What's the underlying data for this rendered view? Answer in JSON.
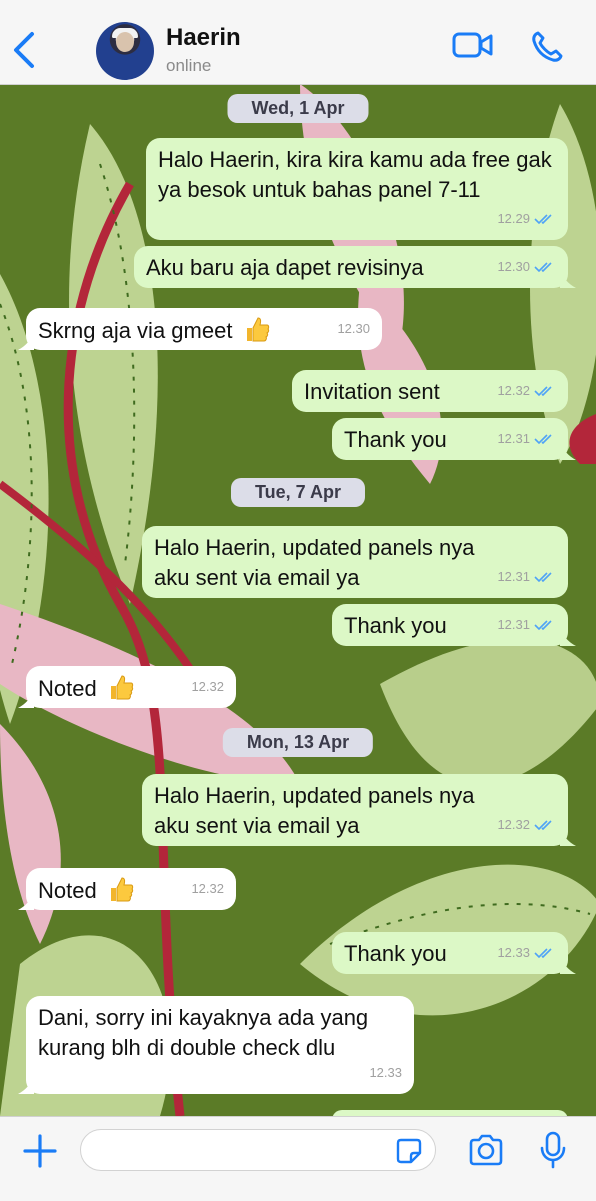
{
  "header": {
    "contact_name": "Haerin",
    "status": "online",
    "accent_color": "#1a7cf6"
  },
  "icons": {
    "back": "chevron-left-icon",
    "video_call": "video-camera-icon",
    "voice_call": "phone-icon",
    "attach": "plus-icon",
    "sticker": "sticker-icon",
    "camera": "camera-icon",
    "mic": "microphone-icon",
    "read_receipt": "double-check-icon",
    "thumbs": "thumbs-up-emoji"
  },
  "dates": [
    "Wed, 1 Apr",
    "Tue, 7 Apr",
    "Mon, 13 Apr"
  ],
  "messages": [
    {
      "dir": "out",
      "text": "Halo Haerin, kira kira kamu ada free gak ya besok untuk bahas panel 7-11",
      "time": "12.29"
    },
    {
      "dir": "out",
      "text": "Aku baru aja dapet revisinya",
      "time": "12.30"
    },
    {
      "dir": "in",
      "text": "Skrng aja via gmeet",
      "time": "12.30",
      "emoji": "thumbs-up"
    },
    {
      "dir": "out",
      "text": "Invitation sent",
      "time": "12.32"
    },
    {
      "dir": "out",
      "text": "Thank you",
      "time": "12.31"
    },
    {
      "dir": "out",
      "text": "Halo Haerin, updated panels nya aku sent via email ya",
      "time": "12.31"
    },
    {
      "dir": "out",
      "text": "Thank you",
      "time": "12.31"
    },
    {
      "dir": "in",
      "text": "Noted",
      "time": "12.32",
      "emoji": "thumbs-up"
    },
    {
      "dir": "out",
      "text": "Halo Haerin, updated panels nya aku sent via email ya",
      "time": "12.32"
    },
    {
      "dir": "in",
      "text": "Noted",
      "time": "12.32",
      "emoji": "thumbs-up"
    },
    {
      "dir": "out",
      "text": "Thank you",
      "time": "12.33"
    },
    {
      "dir": "in",
      "text": "Dani, sorry ini kayaknya ada yang kurang blh di double check dlu",
      "time": "12.33"
    }
  ],
  "composer": {
    "value": "",
    "placeholder": ""
  },
  "colors": {
    "outgoing_bubble": "#dcf8c6",
    "incoming_bubble": "#ffffff",
    "date_pill": "#dcdde8",
    "wallpaper_green": "#5b7b27",
    "wallpaper_pink": "#e8b7c4",
    "wallpaper_red": "#b3263a"
  }
}
